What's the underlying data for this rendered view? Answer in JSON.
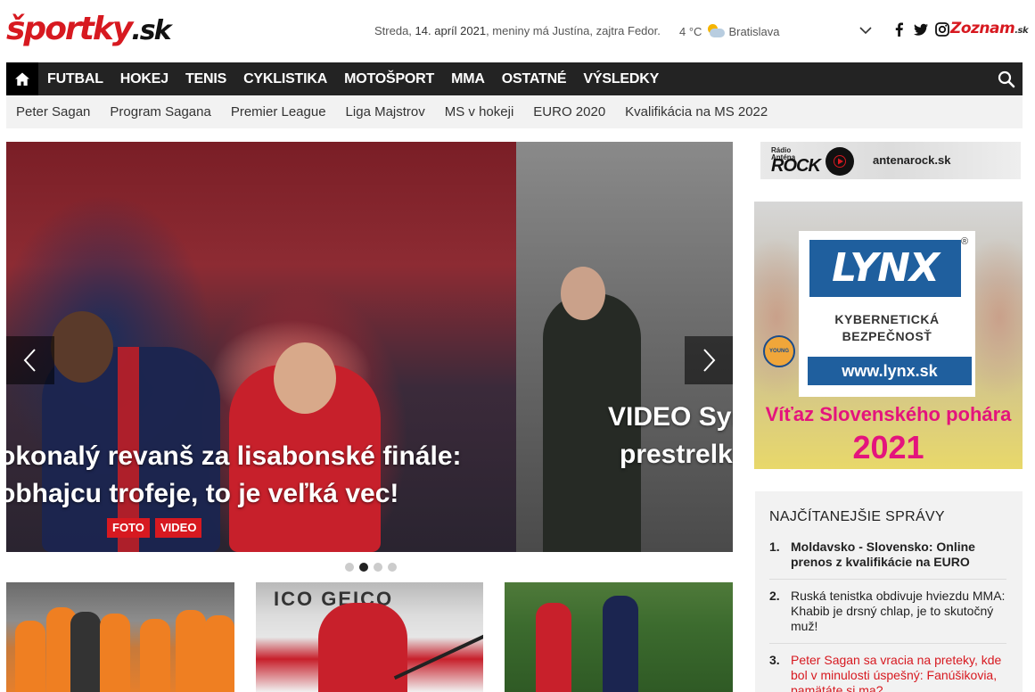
{
  "header": {
    "logo_main": "športky",
    "logo_suffix": ".sk",
    "date_prefix": "Streda,",
    "date_bold": "14. apríl 2021",
    "date_suffix": ", meniny má Justína, zajtra Fedor.",
    "temperature": "4 °C",
    "city": "Bratislava",
    "partner_main": "Zoznam",
    "partner_suffix": ".sk"
  },
  "main_nav": {
    "items": [
      "FUTBAL",
      "HOKEJ",
      "TENIS",
      "CYKLISTIKA",
      "MOTOŠPORT",
      "MMA",
      "OSTATNÉ",
      "VÝSLEDKY"
    ]
  },
  "sub_nav": {
    "items": [
      "Peter Sagan",
      "Program Sagana",
      "Premier League",
      "Liga Majstrov",
      "MS v hokeji",
      "EURO 2020",
      "Kvalifikácia na MS 2022"
    ]
  },
  "slider": {
    "slide1_title_line1": "okonalý revanš za lisabonské finále:",
    "slide1_title_line2": "obhajcu trofeje, to je veľká vec!",
    "slide1_tags": [
      "FOTO",
      "VIDEO"
    ],
    "slide2_title_line1": "VIDEO Syr",
    "slide2_title_line2": "prestrelk",
    "active_dot": 2,
    "dot_count": 4
  },
  "sidebar": {
    "radio_brand_line1": "Rádio",
    "radio_brand_line2": "Anténa",
    "radio_name": "ROCK",
    "radio_url": "antenarock.sk",
    "lynx_logo": "LYNX",
    "lynx_reg": "®",
    "lynx_line1": "KYBERNETICKÁ",
    "lynx_line2": "BEZPEČNOSŤ",
    "lynx_url": "www.lynx.sk",
    "lynx_caption": "Víťaz Slovenského pohára",
    "lynx_year": "2021",
    "young_badge": "YOUNG",
    "most_read_title": "NAJČÍTANEJŠIE SPRÁVY",
    "most_read": [
      {
        "num": "1.",
        "text": "Moldavsko - Slovensko: Online prenos z kvalifikácie na EURO"
      },
      {
        "num": "2.",
        "text": "Ruská tenistka obdivuje hviezdu MMA: Khabib je drsný chlap, je to skutočný muž!"
      },
      {
        "num": "3.",
        "text": "Peter Sagan sa vracia na preteky, kde bol v minulosti úspešný: Fanúšikovia, pamätáte si ma?"
      }
    ]
  },
  "thumbnails": {
    "banner_text": "ICO GEICO"
  },
  "colors": {
    "brand_red": "#d71920",
    "nav_bg": "#232323",
    "subnav_bg": "#f2f2f2",
    "lynx_blue": "#1f5f9e",
    "lynx_pink": "#e4147d"
  }
}
